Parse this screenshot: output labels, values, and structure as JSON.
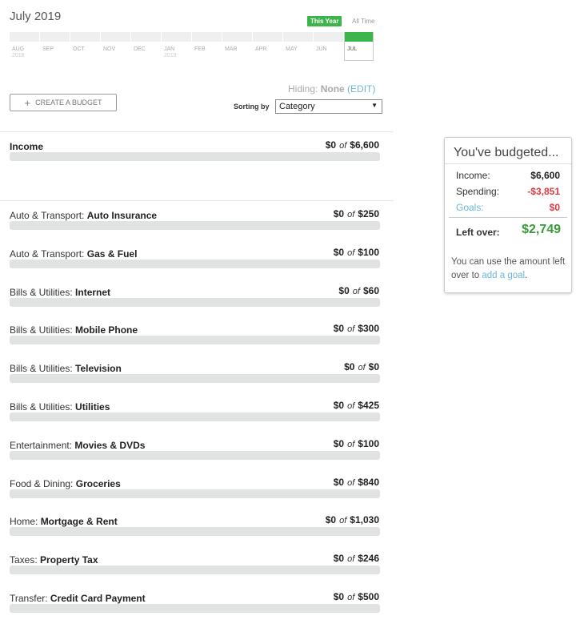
{
  "header": {
    "month_title": "July 2019",
    "this_year_label": "This Year",
    "all_time_label": "All Time"
  },
  "timeline": [
    {
      "label": "AUG",
      "year": "2018"
    },
    {
      "label": "SEP",
      "year": ""
    },
    {
      "label": "OCT",
      "year": ""
    },
    {
      "label": "NOV",
      "year": ""
    },
    {
      "label": "DEC",
      "year": ""
    },
    {
      "label": "JAN",
      "year": "2019"
    },
    {
      "label": "FEB",
      "year": ""
    },
    {
      "label": "MAR",
      "year": ""
    },
    {
      "label": "APR",
      "year": ""
    },
    {
      "label": "MAY",
      "year": ""
    },
    {
      "label": "JUN",
      "year": ""
    },
    {
      "label": "JUL",
      "year": ""
    }
  ],
  "toolbar": {
    "hiding_label": "Hiding:",
    "hiding_value": "None",
    "edit_label": "(EDIT)",
    "create_budget_label": "CREATE A BUDGET",
    "sorting_label": "Sorting by",
    "sort_value": "Category"
  },
  "income": {
    "label": "Income",
    "spent": "$0",
    "of": "of",
    "total": "$6,600",
    "progress": 0
  },
  "budgets": [
    {
      "category": "Auto & Transport:",
      "sub": "Auto Insurance",
      "spent": "$0",
      "of": "of",
      "total": "$250",
      "progress": 0
    },
    {
      "category": "Auto & Transport:",
      "sub": "Gas & Fuel",
      "spent": "$0",
      "of": "of",
      "total": "$100",
      "progress": 0
    },
    {
      "category": "Bills & Utilities:",
      "sub": "Internet",
      "spent": "$0",
      "of": "of",
      "total": "$60",
      "progress": 0
    },
    {
      "category": "Bills & Utilities:",
      "sub": "Mobile Phone",
      "spent": "$0",
      "of": "of",
      "total": "$300",
      "progress": 0
    },
    {
      "category": "Bills & Utilities:",
      "sub": "Television",
      "spent": "$0",
      "of": "of",
      "total": "$0",
      "progress": 0
    },
    {
      "category": "Bills & Utilities:",
      "sub": "Utilities",
      "spent": "$0",
      "of": "of",
      "total": "$425",
      "progress": 0
    },
    {
      "category": "Entertainment:",
      "sub": "Movies & DVDs",
      "spent": "$0",
      "of": "of",
      "total": "$100",
      "progress": 0
    },
    {
      "category": "Food & Dining:",
      "sub": "Groceries",
      "spent": "$0",
      "of": "of",
      "total": "$840",
      "progress": 0
    },
    {
      "category": "Home:",
      "sub": "Mortgage & Rent",
      "spent": "$0",
      "of": "of",
      "total": "$1,030",
      "progress": 0
    },
    {
      "category": "Taxes:",
      "sub": "Property Tax",
      "spent": "$0",
      "of": "of",
      "total": "$246",
      "progress": 0
    },
    {
      "category": "Transfer:",
      "sub": "Credit Card Payment",
      "spent": "$0",
      "of": "of",
      "total": "$500",
      "progress": 0
    }
  ],
  "summary": {
    "title": "You've budgeted...",
    "income_label": "Income:",
    "income_value": "$6,600",
    "spending_label": "Spending:",
    "spending_value": "-$3,851",
    "goals_label": "Goals:",
    "goals_value": "$0",
    "left_over_label": "Left over:",
    "left_over_value": "$2,749",
    "note_prefix": "You can use the amount left over to",
    "note_link": "add a goal",
    "note_suffix": "."
  },
  "colors": {
    "accent_green": "#3cb54a",
    "negative_red": "#e0393e",
    "link_blue": "#6bb7d8",
    "leftover_green": "#3a9a3a"
  }
}
